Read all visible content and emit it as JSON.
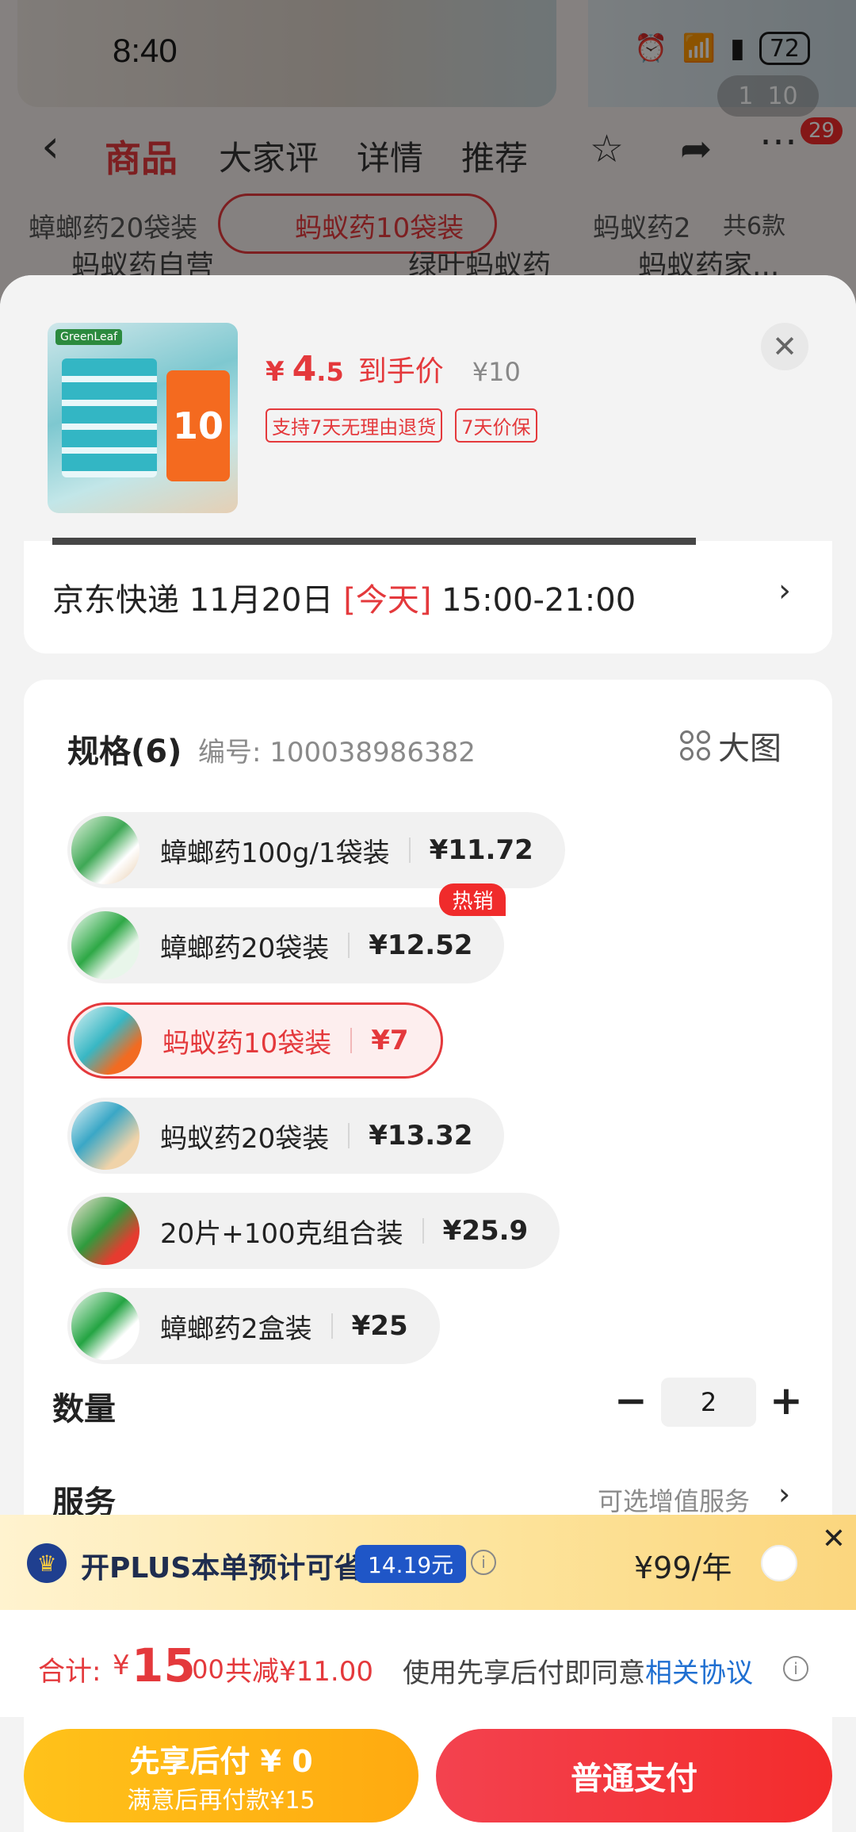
{
  "status_bar": {
    "time": "8:40",
    "battery": "72"
  },
  "background": {
    "page_indicator": {
      "current": "1",
      "total": "10"
    },
    "nav": {
      "tabs": [
        "商品",
        "大家评",
        "详情",
        "推荐"
      ],
      "badge": "29"
    },
    "variants": [
      "蟑螂药20袋装",
      "蚂蚁药10袋装",
      "蚂蚁药2",
      "共6款"
    ],
    "search_chips": [
      "蚂蚁药自营",
      "绿叶蚂蚁药",
      "蚂蚁药家..."
    ]
  },
  "product": {
    "price_symbol": "¥",
    "price_int": "4",
    "price_dec": ".5",
    "price_label": "到手价",
    "original_price": "¥10",
    "tags": [
      "支持7天无理由退货",
      "7天价保"
    ],
    "thumb_brand": "GreenLeaf",
    "thumb_tag": "10"
  },
  "delivery": {
    "carrier": "京东快递 11月20日 ",
    "today": "[今天]",
    "window": " 15:00-21:00"
  },
  "spec": {
    "title": "规格(6)",
    "code": "编号: 100038986382",
    "big_picture": "大图",
    "hot_label": "热销",
    "options": [
      {
        "name": "蟑螂药100g/1袋装",
        "price": "¥11.72"
      },
      {
        "name": "蟑螂药20袋装",
        "price": "¥12.52"
      },
      {
        "name": "蚂蚁药10袋装",
        "price": "¥7"
      },
      {
        "name": "蚂蚁药20袋装",
        "price": "¥13.32"
      },
      {
        "name": "20片+100克组合装",
        "price": "¥25.9"
      },
      {
        "name": "蟑螂药2盒装",
        "price": "¥25"
      }
    ]
  },
  "quantity": {
    "label": "数量",
    "value": "2"
  },
  "service": {
    "label": "服务",
    "value": "可选增值服务"
  },
  "plus": {
    "text": "开PLUS本单预计可省",
    "save": "14.19元",
    "price": "¥99/年"
  },
  "total": {
    "label": "合计:",
    "symbol": "¥",
    "amount": "15",
    "cents": ".00",
    "reduce": "共减¥11.00",
    "agree_prefix": "使用先享后付即同意",
    "agree_link": "相关协议"
  },
  "buttons": {
    "pay_later_l1": "先享后付 ¥ 0",
    "pay_later_l2": "满意后再付款¥15",
    "pay_normal": "普通支付"
  },
  "colors": {
    "accent": "#e4393c",
    "plus_blue": "#1f56c7",
    "pay_later": "#ffb515",
    "pay_normal": "#f3354a"
  }
}
